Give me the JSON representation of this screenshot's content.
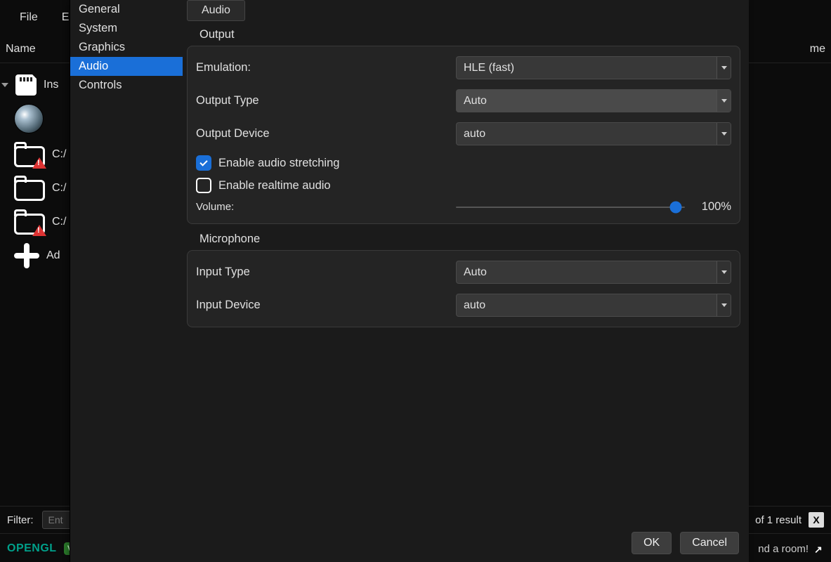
{
  "menubar": {
    "file": "File",
    "emulation": "En"
  },
  "columns": {
    "name": "Name",
    "right": "me"
  },
  "gamelist": {
    "installed": "Ins",
    "path1": "C:/",
    "path2": "C:/",
    "path3": "C:/",
    "add": "Ad"
  },
  "sidebar": {
    "items": [
      "General",
      "System",
      "Graphics",
      "Audio",
      "Controls"
    ]
  },
  "settings": {
    "tab": "Audio",
    "output": {
      "label": "Output",
      "emulation_label": "Emulation:",
      "emulation_value": "HLE (fast)",
      "outtype_label": "Output Type",
      "outtype_value": "Auto",
      "outdev_label": "Output Device",
      "outdev_value": "auto",
      "stretch_label": "Enable audio stretching",
      "realtime_label": "Enable realtime audio",
      "volume_label": "Volume:",
      "volume_value": "100%"
    },
    "microphone": {
      "label": "Microphone",
      "intype_label": "Input Type",
      "intype_value": "Auto",
      "indev_label": "Input Device",
      "indev_value": "auto"
    },
    "ok": "OK",
    "cancel": "Cancel"
  },
  "filterbar": {
    "label": "Filter:",
    "placeholder": "Ent",
    "results": "of 1 result",
    "close": "X"
  },
  "statusbar": {
    "opengl": "OPENGL",
    "v": "V",
    "room": "nd a room!"
  }
}
